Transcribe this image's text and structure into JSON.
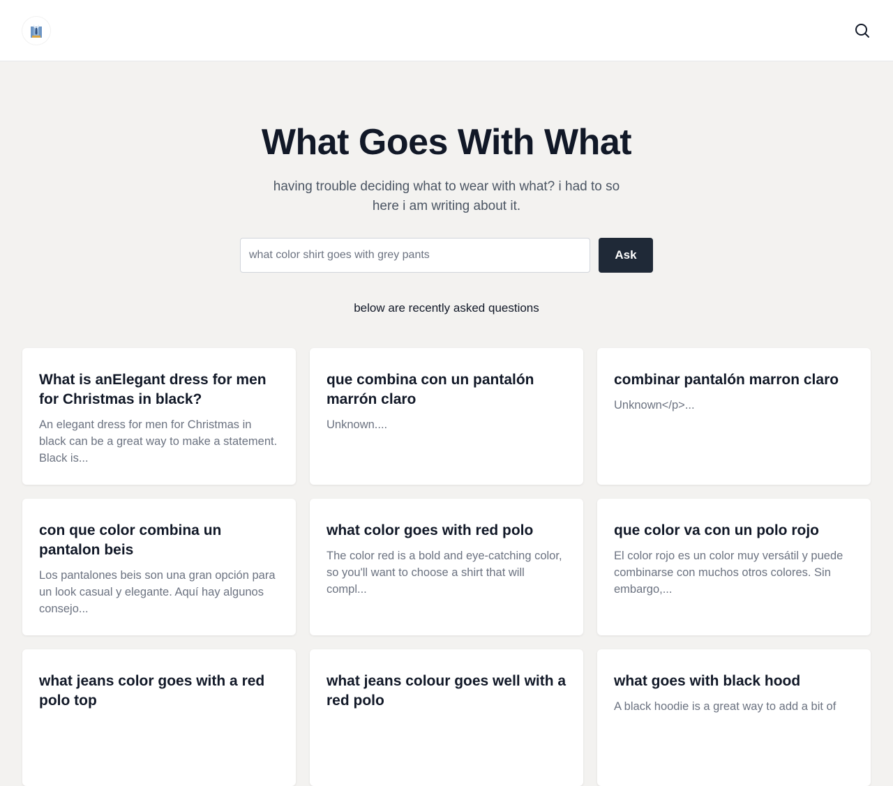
{
  "header": {
    "logo_icon": "shirt-logo-icon",
    "search_icon": "search-icon"
  },
  "hero": {
    "title": "What Goes With What",
    "subtitle": "having trouble deciding what to wear with what? i had to so here i am writing about it."
  },
  "ask_form": {
    "placeholder": "what color shirt goes with grey pants",
    "button_label": "Ask"
  },
  "recent": {
    "label": "below are recently asked questions",
    "questions": [
      {
        "title": "What is anElegant dress for men for Christmas in black?",
        "excerpt": "An elegant dress for men for Christmas in black can be a great way to make a statement. Black is..."
      },
      {
        "title": "que combina con un pantalón marrón claro",
        "excerpt": "Unknown...."
      },
      {
        "title": "combinar pantalón marron claro",
        "excerpt": "Unknown</p>..."
      },
      {
        "title": "con que color combina un pantalon beis",
        "excerpt": "Los pantalones beis son una gran opción para un look casual y elegante. Aquí hay algunos consejo..."
      },
      {
        "title": "what color goes with red polo",
        "excerpt": "The color red is a bold and eye-catching color, so you'll want to choose a shirt that will compl..."
      },
      {
        "title": "que color va con un polo rojo",
        "excerpt": "El color rojo es un color muy versátil y puede combinarse con muchos otros colores. Sin embargo,..."
      },
      {
        "title": "what jeans color goes with a red polo top",
        "excerpt": ""
      },
      {
        "title": "what jeans colour goes well with a red polo",
        "excerpt": ""
      },
      {
        "title": "what goes with black hood",
        "excerpt": "A black hoodie is a great way to add a bit of"
      }
    ]
  },
  "colors": {
    "page_background": "#f3f2f0",
    "button_background": "#1f2937",
    "title_text": "#111827",
    "muted_text": "#6b7280"
  }
}
